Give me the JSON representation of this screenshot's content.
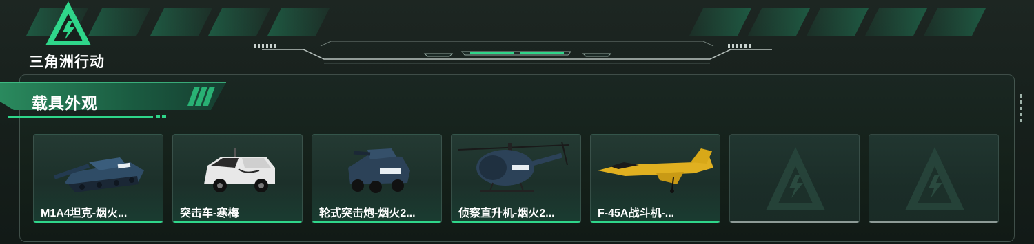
{
  "app": {
    "logo_text": "三角洲行动",
    "logo_icon": "lightning-triangle-icon"
  },
  "colors": {
    "accent": "#2fd68a",
    "panel_border": "#3c4c46",
    "empty_bar": "#8d9a96"
  },
  "section": {
    "title": "载具外观"
  },
  "vehicles": [
    {
      "label": "M1A4坦克-烟火...",
      "icon": "tank-icon",
      "rarity_color": "#2fd68a"
    },
    {
      "label": "突击车-寒梅",
      "icon": "assault-vehicle-icon",
      "rarity_color": "#2fd68a"
    },
    {
      "label": "轮式突击炮-烟火2...",
      "icon": "wheeled-assault-gun-icon",
      "rarity_color": "#2fd68a"
    },
    {
      "label": "侦察直升机-烟火2...",
      "icon": "scout-helicopter-icon",
      "rarity_color": "#2fd68a"
    },
    {
      "label": "F-45A战斗机-...",
      "icon": "fighter-jet-icon",
      "rarity_color": "#2fd68a"
    }
  ],
  "empty_slots": 2
}
